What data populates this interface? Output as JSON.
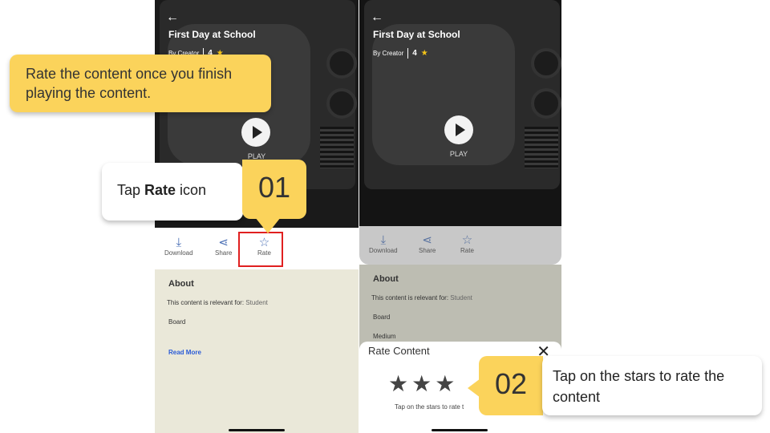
{
  "left_screen": {
    "title": "First Day at School",
    "by": "By Creator",
    "rating": "4",
    "play_label": "PLAY",
    "actions": {
      "download": "Download",
      "share": "Share",
      "rate": "Rate"
    },
    "about": {
      "heading": "About",
      "relevant_label": "This content is relevant for:",
      "relevant_value": "Student",
      "board": "Board",
      "read_more": "Read More"
    }
  },
  "right_screen": {
    "title": "First Day at School",
    "by": "By Creator",
    "rating": "4",
    "play_label": "PLAY",
    "actions": {
      "download": "Download",
      "share": "Share",
      "rate": "Rate"
    },
    "about": {
      "heading": "About",
      "relevant_label": "This content is relevant for:",
      "relevant_value": "Student",
      "board": "Board",
      "medium": "Medium"
    },
    "sheet": {
      "title": "Rate Content",
      "stars": "★★★",
      "hint": "Tap on the stars to rate t"
    }
  },
  "callouts": {
    "intro": "Rate the content once you finish playing the content.",
    "step1": {
      "prefix": "Tap ",
      "bold": "Rate",
      "suffix": " icon",
      "number": "01"
    },
    "step2": {
      "text": "Tap on the stars to rate the content",
      "number": "02"
    }
  },
  "colors": {
    "accent": "#fbd35b",
    "highlight": "#e02020",
    "link": "#2a5bd7",
    "star": "#f5c518"
  }
}
